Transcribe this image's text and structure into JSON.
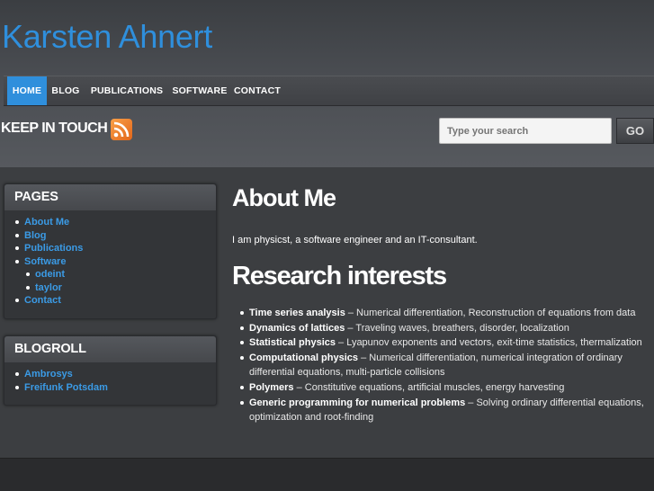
{
  "site": {
    "title": "Karsten Ahnert"
  },
  "nav": [
    {
      "label": "HOME",
      "active": true
    },
    {
      "label": "BLOG"
    },
    {
      "label": "PUBLICATIONS"
    },
    {
      "label": "SOFTWARE"
    },
    {
      "label": "CONTACT"
    }
  ],
  "header": {
    "keep_in_touch": "KEEP IN TOUCH",
    "search_placeholder": "Type your search",
    "go_label": "GO"
  },
  "sidebar": {
    "pages": {
      "title": "PAGES",
      "items": [
        "About Me",
        "Blog",
        "Publications",
        "Software",
        "odeint",
        "taylor",
        "Contact"
      ]
    },
    "blogroll": {
      "title": "BLOGROLL",
      "items": [
        "Ambrosys",
        "Freifunk Potsdam"
      ]
    }
  },
  "main": {
    "heading": "About Me",
    "intro": "I am physicst, a software engineer and an IT-consultant.",
    "research_heading": "Research interests",
    "research": [
      {
        "term": "Time series analysis",
        "desc": " – Numerical differentiation, Reconstruction of equations from data"
      },
      {
        "term": "Dynamics of lattices",
        "desc": " – Traveling waves, breathers, disorder, localization"
      },
      {
        "term": "Statistical physics",
        "desc": " – Lyapunov exponents and vectors, exit-time statistics, thermalization"
      },
      {
        "term": "Computational physics",
        "desc": " – Numerical differentiation, numerical integration of ordinary differential equations, multi-particle collisions"
      },
      {
        "term": "Polymers",
        "desc": " – Constitutive equations, artificial muscles, energy harvesting"
      },
      {
        "term": "Generic programming for numerical problems",
        "desc": " – Solving ordinary differential equations, optimization and root-finding"
      }
    ]
  },
  "colors": {
    "accent": "#2f8fdc",
    "link": "#3b9be6"
  },
  "icons": {
    "feed": "rss-icon"
  }
}
